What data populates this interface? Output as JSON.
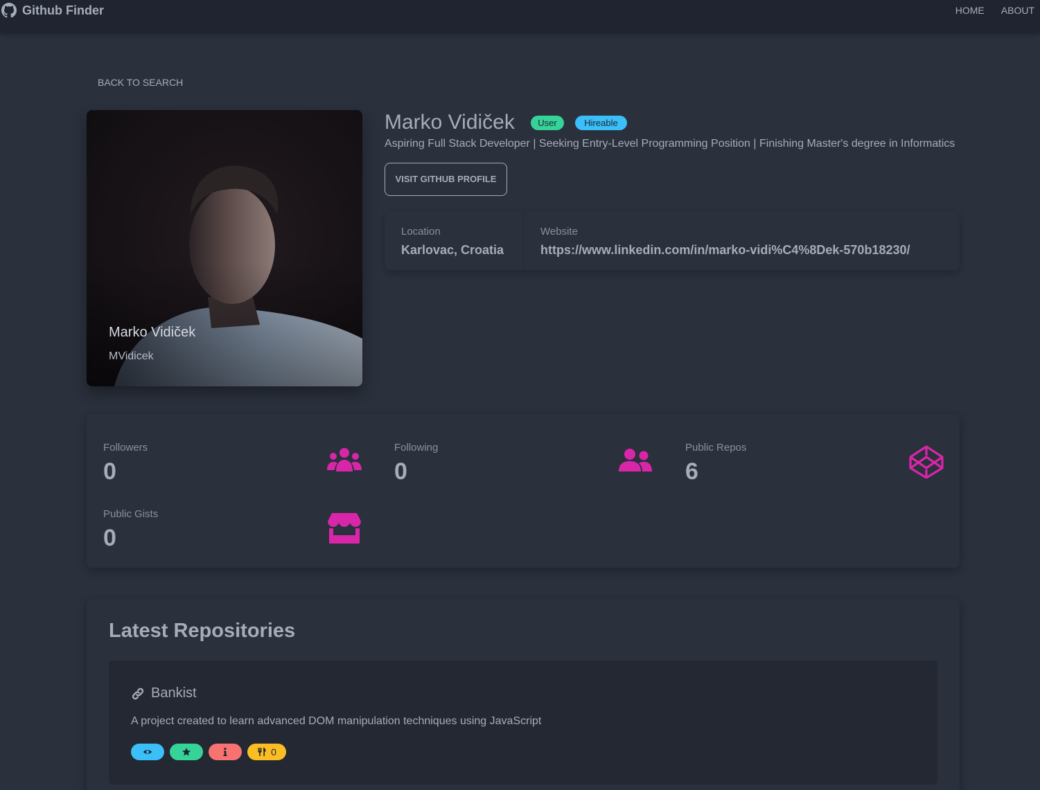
{
  "navbar": {
    "brand": "Github Finder",
    "links": [
      "HOME",
      "ABOUT"
    ]
  },
  "back_link": "BACK TO SEARCH",
  "avatar": {
    "name": "Marko Vidiček",
    "login": "MVidicek"
  },
  "profile": {
    "name": "Marko Vidiček",
    "badge_type": "User",
    "badge_hireable": "Hireable",
    "bio": "Aspiring Full Stack Developer | Seeking Entry-Level Programming Position | Finishing Master's degree in Informatics",
    "visit_button": "VISIT GITHUB PROFILE"
  },
  "info": {
    "location_title": "Location",
    "location_value": "Karlovac, Croatia",
    "website_title": "Website",
    "website_value": "https://www.linkedin.com/in/marko-vidi%C4%8Dek-570b18230/"
  },
  "stats": [
    {
      "title": "Followers",
      "value": "0",
      "icon": "users-icon"
    },
    {
      "title": "Following",
      "value": "0",
      "icon": "user-friends-icon"
    },
    {
      "title": "Public Repos",
      "value": "6",
      "icon": "codepen-icon"
    },
    {
      "title": "Public Gists",
      "value": "0",
      "icon": "store-icon"
    }
  ],
  "repos": {
    "title": "Latest Repositories",
    "items": [
      {
        "name": "Bankist",
        "description": "A project created to learn advanced DOM manipulation techniques using JavaScript",
        "forks": "0"
      }
    ]
  },
  "colors": {
    "background": "#2a303c",
    "navbar": "#1f2430",
    "accent_icons": "#d926a9",
    "badge_user": "#36d399",
    "badge_hireable": "#3abff8",
    "pill_watch": "#3abff8",
    "pill_star": "#36d399",
    "pill_issue": "#f87272",
    "pill_fork": "#fbbd23"
  }
}
